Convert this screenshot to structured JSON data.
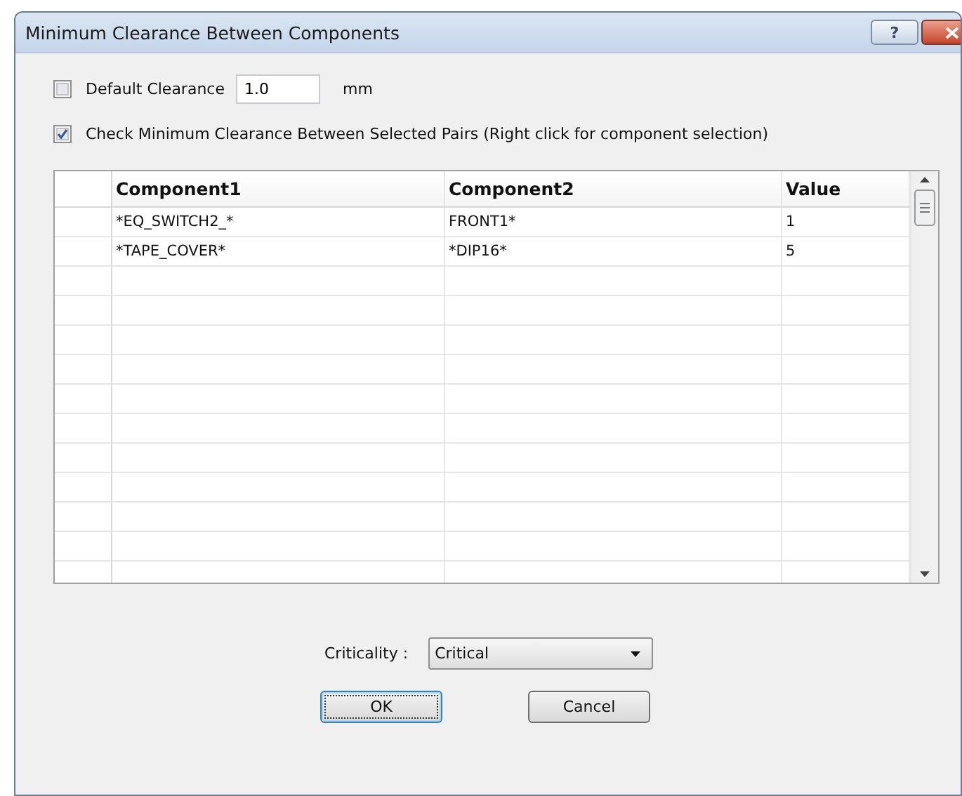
{
  "window": {
    "title": "Minimum Clearance Between Components",
    "help_button": "?"
  },
  "default_clearance": {
    "label": "Default Clearance",
    "checked": false,
    "value": "1.0",
    "unit": "mm"
  },
  "check_pairs": {
    "label": "Check Minimum Clearance Between Selected Pairs (Right click for component selection)",
    "checked": true
  },
  "table": {
    "columns": [
      "Component1",
      "Component2",
      "Value"
    ],
    "rows": [
      {
        "cells": [
          "*EQ_SWITCH2_*",
          "FRONT1*",
          "1"
        ]
      },
      {
        "cells": [
          "*TAPE_COVER*",
          "*DIP16*",
          "5"
        ]
      }
    ]
  },
  "criticality": {
    "label": "Criticality :",
    "value": "Critical"
  },
  "buttons": [
    {
      "label": "OK",
      "focused": true
    },
    {
      "label": "Cancel",
      "focused": false
    }
  ]
}
